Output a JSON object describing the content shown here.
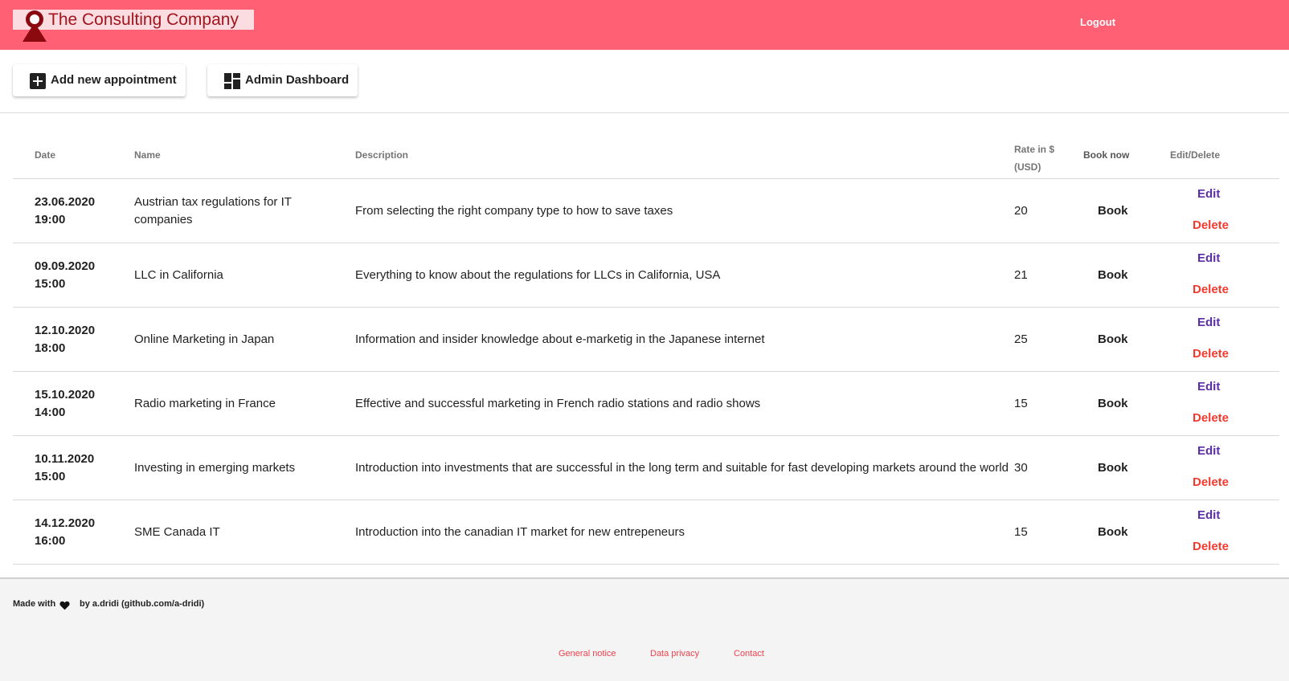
{
  "header": {
    "brand_title": "The Consulting Company",
    "logout_label": "Logout"
  },
  "actions": {
    "add_label": "Add new appointment",
    "admin_label": "Admin Dashboard"
  },
  "table": {
    "headers": {
      "date": "Date",
      "name": "Name",
      "description": "Description",
      "rate_line1": "Rate in $",
      "rate_line2": "(USD)",
      "book": "Book now",
      "edit_delete": "Edit/Delete"
    },
    "rows": [
      {
        "date": "23.06.2020",
        "time": "19:00",
        "name": "Austrian tax regulations for IT companies",
        "description": "From selecting the right company type to how to save taxes",
        "rate": "20",
        "book": "Book",
        "edit": "Edit",
        "delete": "Delete"
      },
      {
        "date": "09.09.2020",
        "time": "15:00",
        "name": "LLC in California",
        "description": "Everything to know about the regulations for LLCs in California, USA",
        "rate": "21",
        "book": "Book",
        "edit": "Edit",
        "delete": "Delete"
      },
      {
        "date": "12.10.2020",
        "time": "18:00",
        "name": "Online Marketing in Japan",
        "description": "Information and insider knowledge about e-marketig in the Japanese internet",
        "rate": "25",
        "book": "Book",
        "edit": "Edit",
        "delete": "Delete"
      },
      {
        "date": "15.10.2020",
        "time": "14:00",
        "name": "Radio marketing in France",
        "description": "Effective and successful marketing in French radio stations and radio shows",
        "rate": "15",
        "book": "Book",
        "edit": "Edit",
        "delete": "Delete"
      },
      {
        "date": "10.11.2020",
        "time": "15:00",
        "name": "Investing in emerging markets",
        "description": "Introduction into investments that are successful in the long term and suitable for fast developing markets around the world",
        "rate": "30",
        "book": "Book",
        "edit": "Edit",
        "delete": "Delete"
      },
      {
        "date": "14.12.2020",
        "time": "16:00",
        "name": "SME Canada IT",
        "description": "Introduction into the canadian IT market for new entrepeneurs",
        "rate": "15",
        "book": "Book",
        "edit": "Edit",
        "delete": "Delete"
      }
    ]
  },
  "footer": {
    "made_with": "Made with",
    "by": "by a.dridi (github.com/a-dridi)",
    "links": [
      "General notice",
      "Data privacy",
      "Contact"
    ]
  },
  "colors": {
    "topbar": "#ff6074",
    "brand_bg": "#fbdde1",
    "brand_text": "#a3141d",
    "edit": "#5b2da6",
    "delete": "#f23a2e",
    "footer_link": "#f0424d"
  },
  "icons": [
    "logo-pin-icon",
    "plus-box-icon",
    "dashboard-icon",
    "heart-icon"
  ]
}
